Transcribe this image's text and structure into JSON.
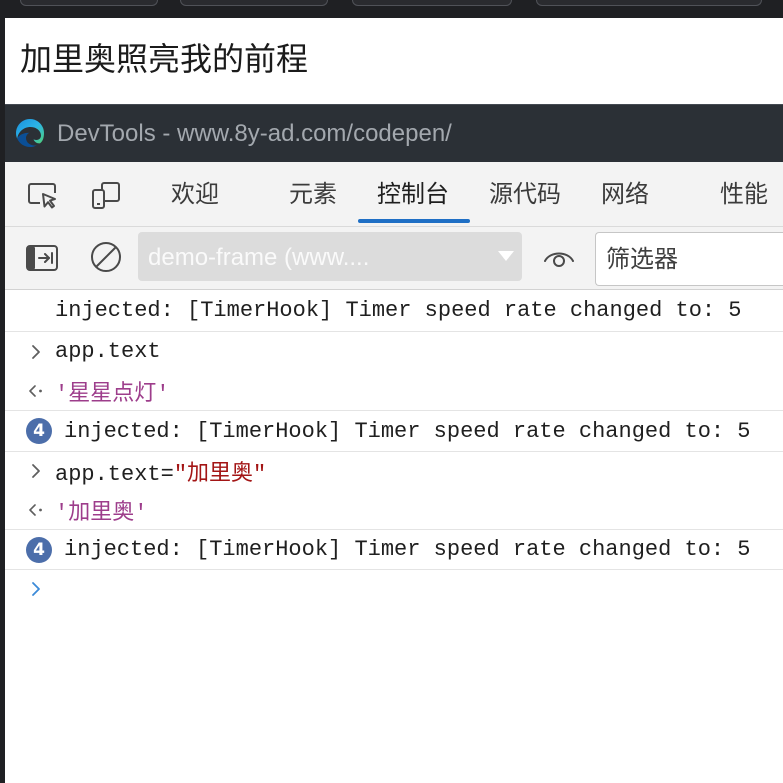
{
  "page": {
    "heading": "加里奥照亮我的前程"
  },
  "devtools": {
    "title": "DevTools - www.8y-ad.com/codepen/",
    "tabs": [
      {
        "label": "欢迎",
        "selected": false
      },
      {
        "label": "元素",
        "selected": false
      },
      {
        "label": "控制台",
        "selected": true
      },
      {
        "label": "源代码",
        "selected": false
      },
      {
        "label": "网络",
        "selected": false
      },
      {
        "label": "性能",
        "selected": false
      }
    ],
    "toolbar": {
      "context": "demo-frame (www....",
      "filter_placeholder": "筛选器"
    },
    "console": {
      "messages": [
        {
          "text": "injected: [TimerHook] Timer speed rate changed to: 5"
        },
        {
          "icon": "input-chevron-icon",
          "text": "app.text"
        },
        {
          "icon": "result-arrow-icon",
          "text": "'星星点灯'"
        },
        {
          "count": 4,
          "text": "injected: [TimerHook] Timer speed rate changed to: 5"
        },
        {
          "icon": "input-chevron-icon",
          "code": "app.text=",
          "string": "\"加里奥\""
        },
        {
          "icon": "result-arrow-icon",
          "text": "'加里奥'"
        },
        {
          "count": 4,
          "text": "injected: [TimerHook] Timer speed rate changed to: 5"
        }
      ]
    }
  },
  "icons": {
    "app": "edge-logo-icon",
    "inspect": "inspect-element-icon",
    "device": "device-emulation-icon",
    "sidebar": "console-sidebar-icon",
    "clear": "clear-console-icon",
    "live_expression": "eye-icon",
    "context_dropdown": "dropdown-arrow-icon",
    "prompt": "prompt-chevron-icon"
  },
  "colors": {
    "accent": "#1f6fc5",
    "titlebar": "#2b3036",
    "string-result": "#9d3d8b",
    "string-input": "#a31515",
    "badge": "#4c6eaa",
    "prompt": "#3b8ad8"
  }
}
